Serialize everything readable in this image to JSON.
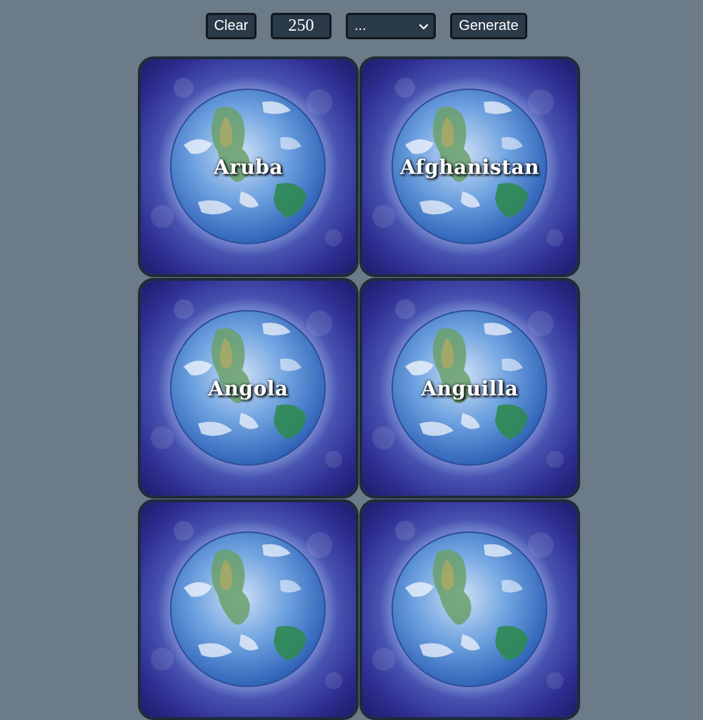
{
  "toolbar": {
    "clear_label": "Clear",
    "count_value": "250",
    "preset_selected": "...",
    "generate_label": "Generate"
  },
  "cards": [
    {
      "label": "Aruba"
    },
    {
      "label": "Afghanistan"
    },
    {
      "label": "Angola"
    },
    {
      "label": "Anguilla"
    }
  ],
  "colors": {
    "page_bg": "#6b7b87",
    "control_bg": "#2b3a48",
    "card_border": "#1e2b38"
  }
}
